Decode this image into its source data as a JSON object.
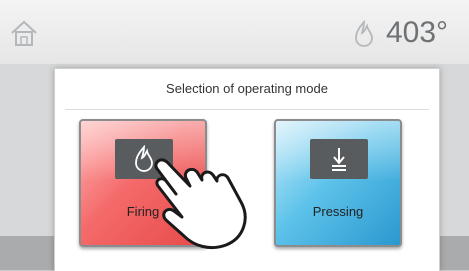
{
  "header": {
    "home_icon": "home-icon",
    "flame_icon": "flame-icon",
    "temperature": "403°"
  },
  "dialog": {
    "title": "Selection of operating mode",
    "modes": [
      {
        "label": "Firing",
        "icon": "flame-icon",
        "color": "#e84a4a",
        "pressed": true
      },
      {
        "label": "Pressing",
        "icon": "press-down-icon",
        "color": "#2a98cf",
        "pressed": false
      }
    ]
  },
  "overlay": {
    "icon": "pointing-hand-icon"
  },
  "colors": {
    "firing_accent": "#f46a6a",
    "pressing_accent": "#5ec3ea",
    "icon_box": "#585c5f"
  }
}
